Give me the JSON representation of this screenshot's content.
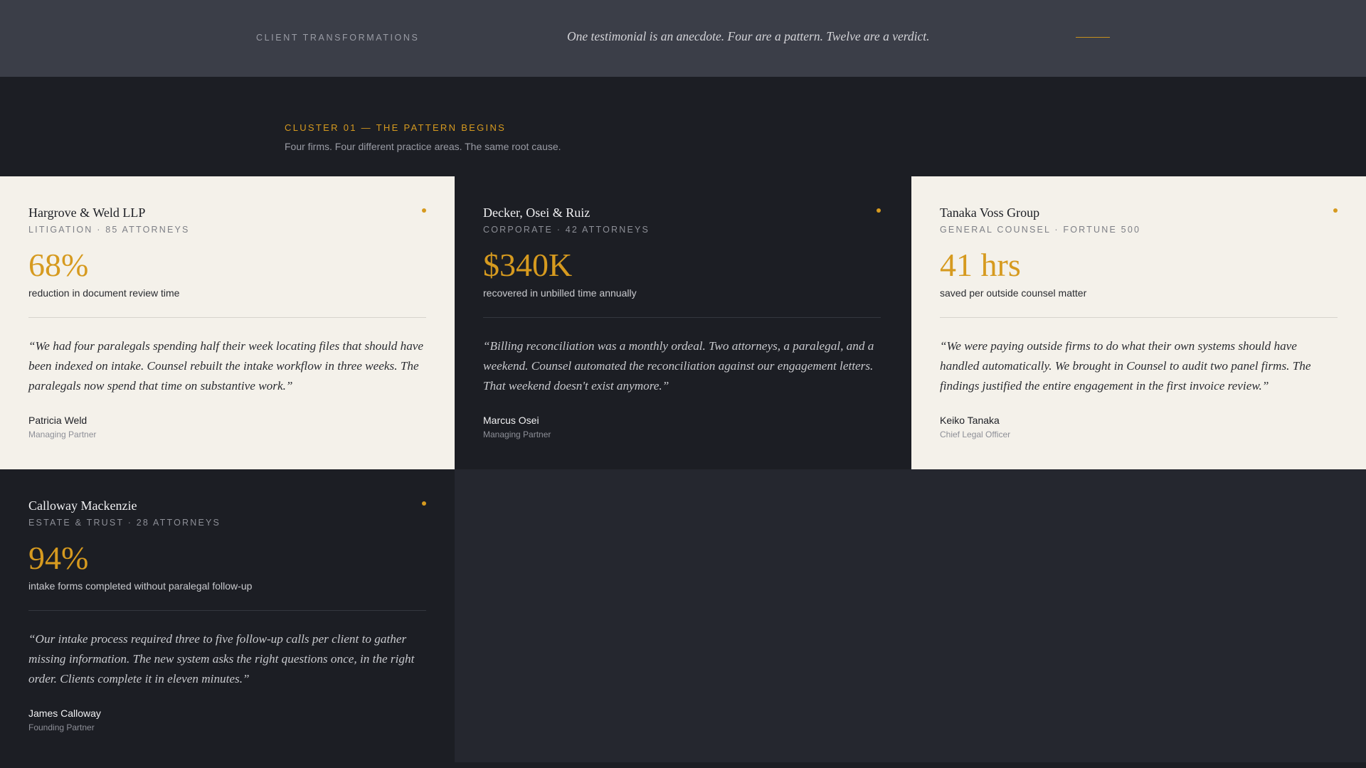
{
  "header": {
    "eyebrow": "CLIENT TRANSFORMATIONS",
    "tagline": "One testimonial is an anecdote. Four are a pattern. Twelve are a verdict."
  },
  "cluster": {
    "label": "CLUSTER 01 — THE PATTERN BEGINS",
    "description": "Four firms. Four different practice areas. The same root cause."
  },
  "cards": [
    {
      "theme": "light",
      "firm": "Hargrove & Weld LLP",
      "meta": "LITIGATION · 85 ATTORNEYS",
      "stat": "68%",
      "stat_desc": "reduction in document review time",
      "quote": "“We had four paralegals spending half their week locating files that should have been indexed on intake. Counsel rebuilt the intake workflow in three weeks. The paralegals now spend that time on substantive work.”",
      "person": "Patricia Weld",
      "role": "Managing Partner"
    },
    {
      "theme": "dark",
      "firm": "Decker, Osei & Ruiz",
      "meta": "CORPORATE · 42 ATTORNEYS",
      "stat": "$340K",
      "stat_desc": "recovered in unbilled time annually",
      "quote": "“Billing reconciliation was a monthly ordeal. Two attorneys, a paralegal, and a weekend. Counsel automated the reconciliation against our engagement letters. That weekend doesn't exist anymore.”",
      "person": "Marcus Osei",
      "role": "Managing Partner"
    },
    {
      "theme": "light",
      "firm": "Tanaka Voss Group",
      "meta": "GENERAL COUNSEL · FORTUNE 500",
      "stat": "41 hrs",
      "stat_desc": "saved per outside counsel matter",
      "quote": "“We were paying outside firms to do what their own systems should have handled automatically. We brought in Counsel to audit two panel firms. The findings justified the entire engagement in the first invoice review.”",
      "person": "Keiko Tanaka",
      "role": "Chief Legal Officer"
    },
    {
      "theme": "dark",
      "firm": "Calloway Mackenzie",
      "meta": "ESTATE & TRUST · 28 ATTORNEYS",
      "stat": "94%",
      "stat_desc": "intake forms completed without paralegal follow-up",
      "quote": "“Our intake process required three to five follow-up calls per client to gather missing information. The new system asks the right questions once, in the right order. Clients complete it in eleven minutes.”",
      "person": "James Calloway",
      "role": "Founding Partner"
    }
  ],
  "colors": {
    "accent": "#d69a1f",
    "header_bg": "#3b3e48",
    "dark_bg": "#1c1e24",
    "light_bg": "#f4f1ea",
    "panel_bg": "#25272f"
  }
}
